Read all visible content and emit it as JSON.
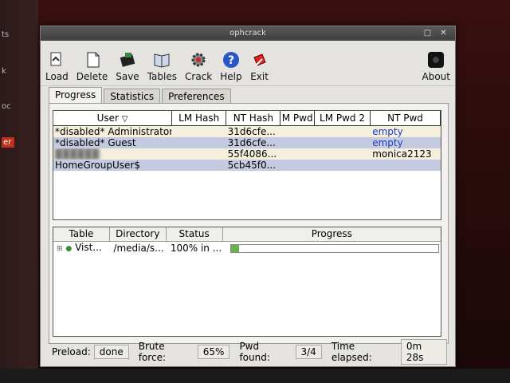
{
  "window": {
    "title": "ophcrack"
  },
  "desktop": {
    "left_items": [
      "ts",
      "k",
      "oc",
      "er"
    ],
    "selected": "er"
  },
  "toolbar": [
    {
      "label": "Load",
      "icon": "load-icon"
    },
    {
      "label": "Delete",
      "icon": "delete-icon"
    },
    {
      "label": "Save",
      "icon": "save-icon"
    },
    {
      "label": "Tables",
      "icon": "tables-icon"
    },
    {
      "label": "Crack",
      "icon": "crack-icon"
    },
    {
      "label": "Help",
      "icon": "help-icon"
    },
    {
      "label": "Exit",
      "icon": "exit-icon"
    }
  ],
  "about": {
    "label": "About",
    "icon": "about-icon"
  },
  "tabs": [
    {
      "label": "Progress",
      "active": true
    },
    {
      "label": "Statistics",
      "active": false
    },
    {
      "label": "Preferences",
      "active": false
    }
  ],
  "users": {
    "columns": [
      "User",
      "LM Hash",
      "NT Hash",
      "M Pwd",
      "LM Pwd 2",
      "NT Pwd"
    ],
    "rows": [
      {
        "user": "*disabled* Administrator",
        "lm": "",
        "nt": "31d6cfe...",
        "lm1": "",
        "lm2": "",
        "ntpwd": "empty"
      },
      {
        "user": "*disabled* Guest",
        "lm": "",
        "nt": "31d6cfe...",
        "lm1": "",
        "lm2": "",
        "ntpwd": "empty"
      },
      {
        "user": "",
        "lm": "",
        "nt": "55f4086...",
        "lm1": "",
        "lm2": "",
        "ntpwd": "monica2123"
      },
      {
        "user": "HomeGroupUser$",
        "lm": "",
        "nt": "5cb45f0...",
        "lm1": "",
        "lm2": "",
        "ntpwd": ""
      }
    ]
  },
  "tables": {
    "columns": [
      "Table",
      "Directory",
      "Status",
      "Progress"
    ],
    "rows": [
      {
        "table": "Vist...",
        "directory": "/media/s...",
        "status": "100% in ...",
        "progress": 0.03
      }
    ]
  },
  "status": {
    "preload_label": "Preload:",
    "preload": "done",
    "brute_label": "Brute force:",
    "brute": "65%",
    "found_label": "Pwd found:",
    "found": "3/4",
    "elapsed_label": "Time elapsed:",
    "elapsed": "0m 28s"
  },
  "colors": {
    "accent": "#1c3cc0",
    "progress": "#6ab04c",
    "row_alt": "#c4cbe0"
  }
}
